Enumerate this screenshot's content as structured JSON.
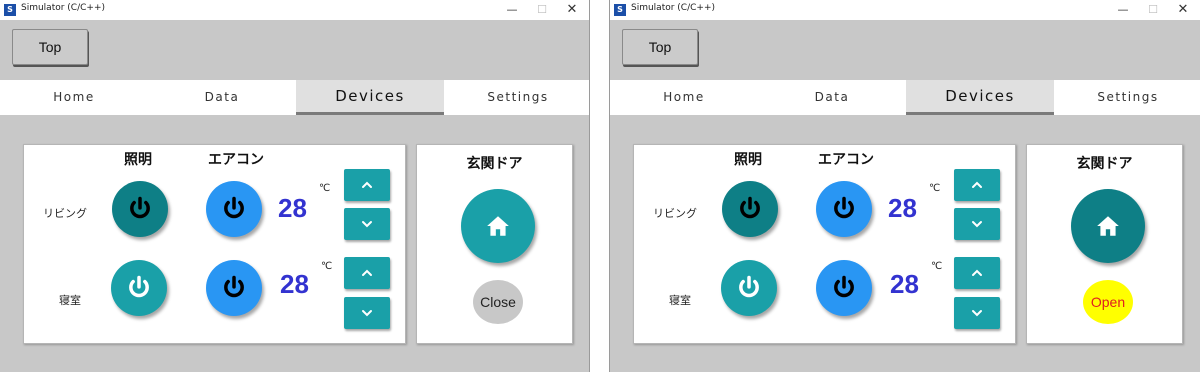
{
  "windows": [
    {
      "title": "Simulator (C/C++)",
      "app_icon": "S",
      "top_button": "Top",
      "tabs": [
        "Home",
        "Data",
        "Devices",
        "Settings"
      ],
      "active_tab": "Devices",
      "headers": {
        "light": "照明",
        "ac": "エアコン"
      },
      "rooms": [
        {
          "name": "リビング",
          "light_color": "#0e7f86",
          "ac_color": "#2996f3",
          "temp": "28",
          "unit": "℃"
        },
        {
          "name": "寝室",
          "light_color": "#1aa0a8",
          "ac_color": "#2996f3",
          "temp": "28",
          "unit": "℃"
        }
      ],
      "door": {
        "title": "玄関ドア",
        "button_color": "#1aa0a8",
        "state_label": "Close",
        "state_bg": "#c8c8c8",
        "state_color": "#222222"
      }
    },
    {
      "title": "Simulator (C/C++)",
      "app_icon": "S",
      "top_button": "Top",
      "tabs": [
        "Home",
        "Data",
        "Devices",
        "Settings"
      ],
      "active_tab": "Devices",
      "headers": {
        "light": "照明",
        "ac": "エアコン"
      },
      "rooms": [
        {
          "name": "リビング",
          "light_color": "#0e7f86",
          "ac_color": "#2996f3",
          "temp": "28",
          "unit": "℃"
        },
        {
          "name": "寝室",
          "light_color": "#1aa0a8",
          "ac_color": "#2996f3",
          "temp": "28",
          "unit": "℃"
        }
      ],
      "door": {
        "title": "玄関ドア",
        "button_color": "#0e7f86",
        "state_label": "Open",
        "state_bg": "#ffff00",
        "state_color": "#e02020"
      }
    }
  ],
  "icons": {
    "power": "power-icon",
    "up": "chevron-up-icon",
    "down": "chevron-down-icon",
    "home": "home-icon",
    "minimize": "minimize-icon",
    "maximize": "maximize-icon",
    "close": "close-icon"
  },
  "colors": {
    "accent": "#1aa0a8",
    "background": "#c8c8c8",
    "temp_text": "#3333d0"
  }
}
